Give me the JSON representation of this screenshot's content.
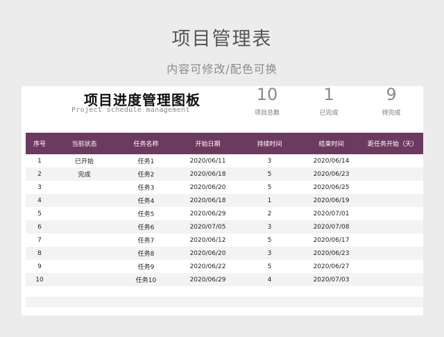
{
  "page": {
    "title": "项目管理表",
    "subtitle": "内容可修改/配色可换"
  },
  "board": {
    "title": "项目进度管理图板",
    "subtitle": "Project schedule management"
  },
  "stats": {
    "total": {
      "value": "10",
      "label": "项目总数"
    },
    "completed": {
      "value": "1",
      "label": "已完成"
    },
    "pending": {
      "value": "9",
      "label": "待完成"
    }
  },
  "colors": {
    "header_bg": "#6d3a5f",
    "page_bg": "#ececec"
  },
  "table": {
    "headers": [
      "序号",
      "当前状态",
      "任务名称",
      "开始日期",
      "持续时间",
      "结束时间",
      "距任务开始（天）"
    ],
    "rows": [
      [
        "1",
        "已开始",
        "任务1",
        "2020/06/11",
        "3",
        "2020/06/14",
        ""
      ],
      [
        "2",
        "完成",
        "任务2",
        "2020/06/18",
        "5",
        "2020/06/23",
        ""
      ],
      [
        "3",
        "",
        "任务3",
        "2020/06/20",
        "5",
        "2020/06/25",
        ""
      ],
      [
        "4",
        "",
        "任务4",
        "2020/06/18",
        "1",
        "2020/06/19",
        ""
      ],
      [
        "5",
        "",
        "任务5",
        "2020/06/29",
        "2",
        "2020/07/01",
        ""
      ],
      [
        "6",
        "",
        "任务6",
        "2020/07/05",
        "3",
        "2020/07/08",
        ""
      ],
      [
        "7",
        "",
        "任务7",
        "2020/06/12",
        "5",
        "2020/06/17",
        ""
      ],
      [
        "8",
        "",
        "任务8",
        "2020/06/20",
        "3",
        "2020/06/23",
        ""
      ],
      [
        "9",
        "",
        "任务9",
        "2020/06/22",
        "5",
        "2020/06/27",
        ""
      ],
      [
        "10",
        "",
        "任务10",
        "2020/06/29",
        "4",
        "2020/07/03",
        ""
      ]
    ]
  }
}
